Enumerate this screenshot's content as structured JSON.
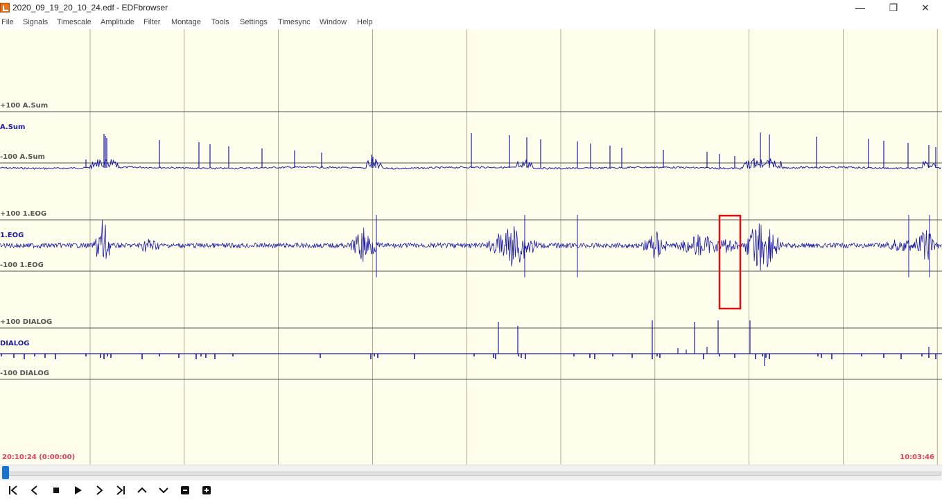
{
  "window": {
    "title": "2020_09_19_20_10_24.edf - EDFbrowser",
    "controls": {
      "minimize": "—",
      "maximize": "❐",
      "close": "✕"
    }
  },
  "menu": {
    "items": [
      "File",
      "Signals",
      "Timescale",
      "Amplitude",
      "Filter",
      "Montage",
      "Tools",
      "Settings",
      "Timesync",
      "Window",
      "Help"
    ]
  },
  "signals": [
    {
      "name": "A.Sum",
      "upper": "+100 A.Sum",
      "lower": "-100 A.Sum",
      "color": "#1a1aaa"
    },
    {
      "name": "1.EOG",
      "upper": "+100 1.EOG",
      "lower": "-100 1.EOG",
      "color": "#1a1aaa"
    },
    {
      "name": "DIALOG",
      "upper": "+100 DIALOG",
      "lower": "-100 DIALOG",
      "color": "#1a1aaa"
    }
  ],
  "timeline": {
    "start": "20:10:24 (0:00:00)",
    "end": "10:03:46",
    "scroll_position": 0.0
  },
  "colors": {
    "background": "#fffdec",
    "trace": "#1a1aaa",
    "grid": "#8a8a6a",
    "baseline": "#555555",
    "highlight": "#e01010",
    "time_label": "#e0405a",
    "scroll_accent": "#1673d2"
  },
  "toolbar": {
    "buttons": [
      {
        "name": "first-page",
        "icon": "skip-to-start-icon"
      },
      {
        "name": "previous",
        "icon": "chevron-left-icon"
      },
      {
        "name": "stop",
        "icon": "stop-icon"
      },
      {
        "name": "play",
        "icon": "play-icon"
      },
      {
        "name": "next",
        "icon": "chevron-right-icon"
      },
      {
        "name": "last-page",
        "icon": "skip-to-end-icon"
      },
      {
        "name": "scroll-up",
        "icon": "chevron-up-icon"
      },
      {
        "name": "scroll-down",
        "icon": "chevron-down-icon"
      },
      {
        "name": "zoom-out",
        "icon": "minus-box-icon"
      },
      {
        "name": "zoom-in",
        "icon": "plus-box-icon"
      }
    ]
  }
}
